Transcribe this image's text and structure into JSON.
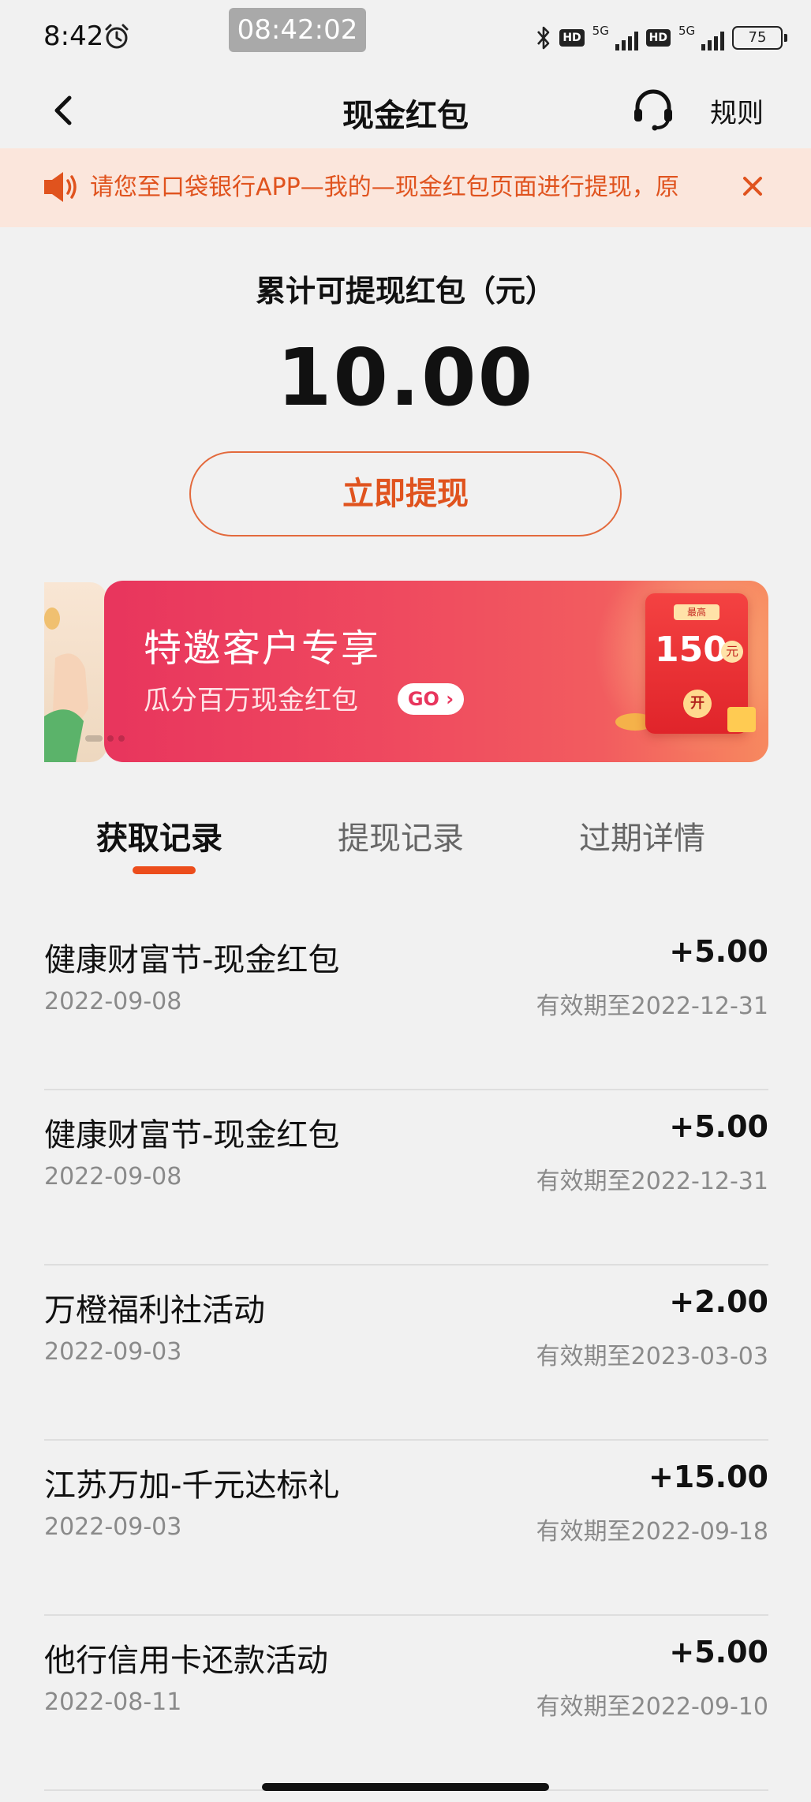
{
  "status_bar": {
    "time": "8:42",
    "overlay_clock": "08:42:02",
    "hd_label": "HD",
    "network_label": "5G",
    "battery": "75"
  },
  "header": {
    "title": "现金红包",
    "rules_label": "规则"
  },
  "notice": {
    "text": "请您至口袋银行APP—我的—现金红包页面进行提现，原"
  },
  "balance": {
    "label": "累计可提现红包（元）",
    "value": "10.00",
    "withdraw_label": "立即提现"
  },
  "banner": {
    "title": "特邀客户专享",
    "subtitle": "瓜分百万现金红包",
    "go_label": "GO ›",
    "envelope_badge": "最高",
    "envelope_amount": "150",
    "envelope_unit": "元",
    "envelope_open": "开"
  },
  "tabs": [
    {
      "label": "获取记录",
      "active": true
    },
    {
      "label": "提现记录",
      "active": false
    },
    {
      "label": "过期详情",
      "active": false
    }
  ],
  "records": [
    {
      "title": "健康财富节-现金红包",
      "amount": "+5.00",
      "date": "2022-09-08",
      "expiry": "有效期至2022-12-31"
    },
    {
      "title": "健康财富节-现金红包",
      "amount": "+5.00",
      "date": "2022-09-08",
      "expiry": "有效期至2022-12-31"
    },
    {
      "title": "万橙福利社活动",
      "amount": "+2.00",
      "date": "2022-09-03",
      "expiry": "有效期至2023-03-03"
    },
    {
      "title": "江苏万加-千元达标礼",
      "amount": "+15.00",
      "date": "2022-09-03",
      "expiry": "有效期至2022-09-18"
    },
    {
      "title": "他行信用卡还款活动",
      "amount": "+5.00",
      "date": "2022-08-11",
      "expiry": "有效期至2022-09-10"
    }
  ],
  "colors": {
    "accent": "#e0531e",
    "notice_bg": "#fbe6dc",
    "banner_start": "#e8355d",
    "banner_end": "#f7895f",
    "background": "#f1f1f1"
  },
  "icons": [
    "alarm-icon",
    "bluetooth-icon",
    "back-arrow-icon",
    "headset-icon",
    "speaker-icon",
    "close-icon"
  ]
}
